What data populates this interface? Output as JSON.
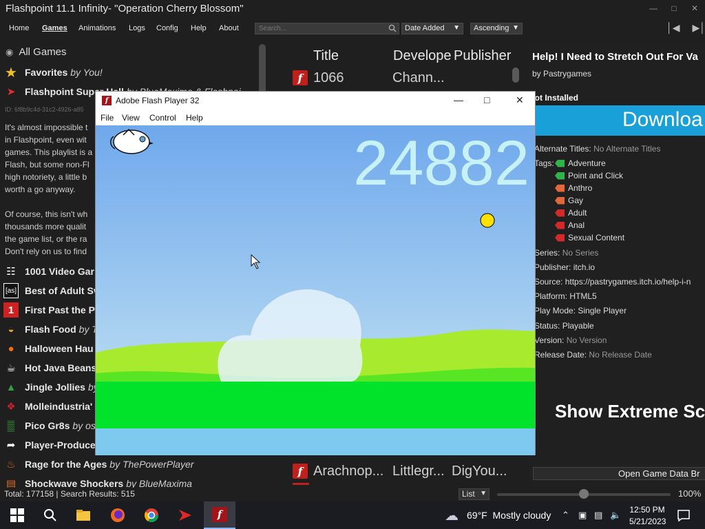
{
  "launcher": {
    "title": "Flashpoint 11.1 Infinity- \"Operation Cherry Blossom\"",
    "menu": [
      "Home",
      "Games",
      "Animations",
      "Logs",
      "Config",
      "Help",
      "About"
    ],
    "active_menu": "Games",
    "search_placeholder": "Search...",
    "sort_by": "Date Added",
    "sort_order": "Ascending"
  },
  "sidebar": {
    "all_games": "All Games",
    "favorites": {
      "name": "Favorites",
      "by": "by",
      "author": "You!"
    },
    "selected": {
      "name": "Flashpoint Super Hall",
      "by": "by",
      "author": "BlueMaxima & Flashpoi"
    },
    "playlist_id": "ID: 6f8b9c4d-31c2-4926-a85",
    "description": [
      "It's almost impossible t",
      "in Flashpoint, even wit",
      "games. This playlist is a",
      "Flash, but some non-Fl",
      "high notoriety, a little b",
      "worth a go anyway.",
      "",
      "Of course, this isn't wh",
      "thousands more qualit",
      "the game list, or the ra",
      "Don't rely on us to find"
    ],
    "playlists": [
      {
        "name": "1001 Video Gar",
        "by": "",
        "author": "",
        "icon": "invader-icon",
        "color": "#ffffff"
      },
      {
        "name": "Best of Adult Sv",
        "by": "",
        "author": "",
        "icon": "as-icon",
        "color": "#ffffff"
      },
      {
        "name": "First Past the Po",
        "by": "",
        "author": "",
        "icon": "number-one-icon",
        "color": "#d02020"
      },
      {
        "name": "Flash Food",
        "by": "by",
        "author": "Tl",
        "icon": "burger-icon",
        "color": "#e8a040"
      },
      {
        "name": "Halloween Hau",
        "by": "",
        "author": "",
        "icon": "pumpkin-icon",
        "color": "#f07010"
      },
      {
        "name": "Hot Java Beans",
        "by": "",
        "author": "",
        "icon": "coffee-icon",
        "color": "#ffffff"
      },
      {
        "name": "Jingle Jollies",
        "by": "by",
        "author": "",
        "icon": "tree-icon",
        "color": "#30a040"
      },
      {
        "name": "Molleindustria'",
        "by": "",
        "author": "",
        "icon": "molle-icon",
        "color": "#d02030"
      },
      {
        "name": "Pico Gr8s",
        "by": "by",
        "author": "osh",
        "icon": "pico-icon",
        "color": "#40c040"
      },
      {
        "name": "Player-Produce",
        "by": "",
        "author": "",
        "icon": "share-icon",
        "color": "#ffffff"
      },
      {
        "name": "Rage for the Ages",
        "by": "by",
        "author": "ThePowerPlayer",
        "icon": "flame-icon",
        "color": "#f06020"
      },
      {
        "name": "Shockwave Shockers",
        "by": "by",
        "author": "BlueMaxima",
        "icon": "shockwave-icon",
        "color": "#e07020"
      }
    ]
  },
  "gamelist": {
    "headers": [
      "Title",
      "Develope",
      "Publisher"
    ],
    "rows": [
      {
        "title": "1066",
        "developer": "Chann...",
        "publisher": ""
      },
      {
        "title": "Arachnop...",
        "developer": "Littlegr...",
        "publisher": "DigYou..."
      }
    ]
  },
  "details": {
    "title": "Help! I Need to Stretch Out For Va",
    "by": "by Pastrygames",
    "status": "Not Installed",
    "download": "Downloa",
    "alternate_titles": {
      "label": "Alternate Titles:",
      "value": "No Alternate Titles"
    },
    "tags_label": "Tags:",
    "tags": [
      {
        "name": "Adventure",
        "color": "#2fb34a"
      },
      {
        "name": "Point and Click",
        "color": "#2fb34a"
      },
      {
        "name": "Anthro",
        "color": "#e0683a"
      },
      {
        "name": "Gay",
        "color": "#e0683a"
      },
      {
        "name": "Adult",
        "color": "#d22a2a"
      },
      {
        "name": "Anal",
        "color": "#d22a2a"
      },
      {
        "name": "Sexual Content",
        "color": "#d22a2a"
      }
    ],
    "series": {
      "label": "Series:",
      "value": "No Series"
    },
    "publisher": {
      "label": "Publisher:",
      "value": "itch.io"
    },
    "source": {
      "label": "Source:",
      "value": "https://pastrygames.itch.io/help-i-n"
    },
    "platform": {
      "label": "Platform:",
      "value": "HTML5"
    },
    "play_mode": {
      "label": "Play Mode:",
      "value": "Single Player"
    },
    "status_row": {
      "label": "Status:",
      "value": "Playable"
    },
    "version": {
      "label": "Version:",
      "value": "No Version"
    },
    "release_date": {
      "label": "Release Date:",
      "value": "No Release Date"
    },
    "extreme": "Show Extreme Sc",
    "open_game_data": "Open Game Data Br"
  },
  "bottombar": {
    "total": "Total: 177158  |  Search Results: 515",
    "view": "List",
    "zoom": "100%",
    "zoom_level": 0.5
  },
  "flash": {
    "title": "Adobe Flash Player 32",
    "menu": [
      "File",
      "View",
      "Control",
      "Help"
    ],
    "score": "24882"
  },
  "taskbar": {
    "weather_temp": "69°F",
    "weather_text": "Mostly cloudy",
    "time": "12:50 PM",
    "date": "5/21/2023"
  }
}
